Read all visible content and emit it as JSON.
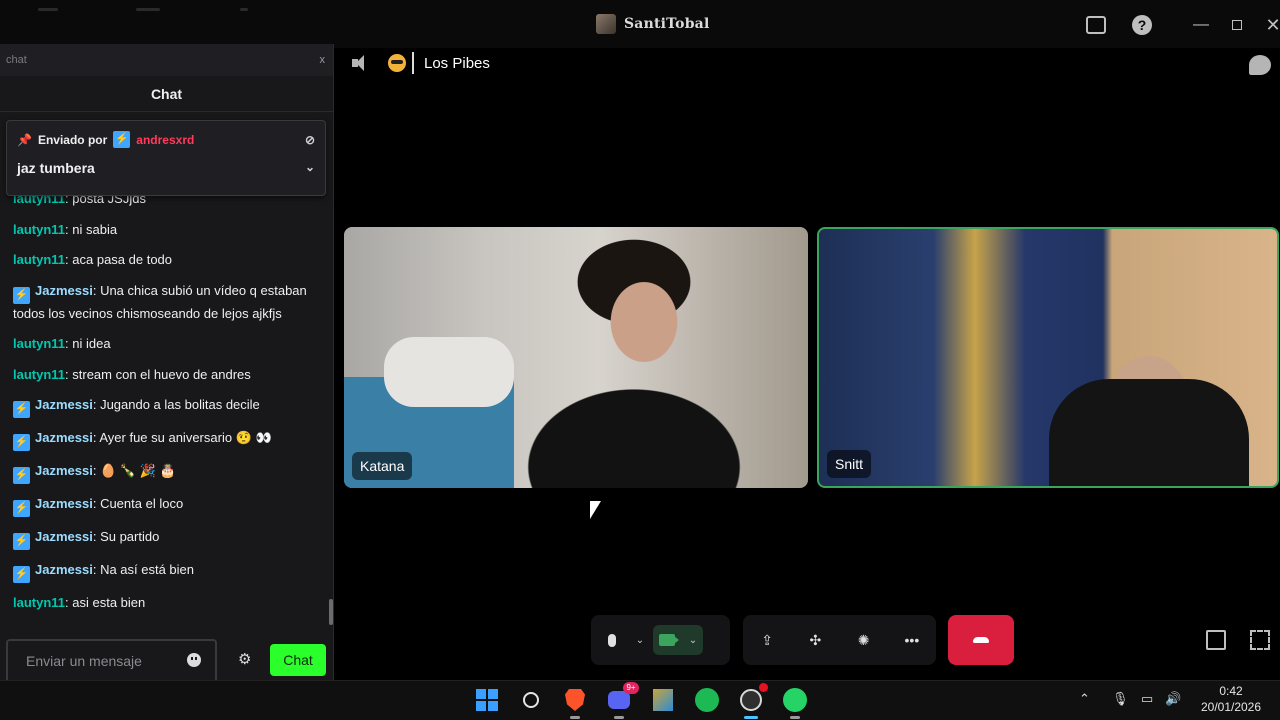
{
  "window": {
    "title": "SantiTobal"
  },
  "chat": {
    "panel_label": "chat",
    "close_label": "x",
    "heading": "Chat",
    "pinned": {
      "prefix": "Enviado por",
      "user": "andresxrd",
      "message": "jaz tumbera"
    },
    "messages": [
      {
        "user": "lautyn11",
        "text": "posta JSJjds",
        "badge": false
      },
      {
        "user": "lautyn11",
        "text": "ni sabia",
        "badge": false
      },
      {
        "user": "lautyn11",
        "text": "aca pasa de todo",
        "badge": false
      },
      {
        "user": "Jazmessi",
        "text": "Una chica subió un vídeo q estaban todos los vecinos chismoseando de lejos ajkfjs",
        "badge": true
      },
      {
        "user": "lautyn11",
        "text": "ni idea",
        "badge": false
      },
      {
        "user": "lautyn11",
        "text": "stream con el huevo de andres",
        "badge": false
      },
      {
        "user": "Jazmessi",
        "text": "Jugando a las bolitas decile",
        "badge": true
      },
      {
        "user": "Jazmessi",
        "text": "Ayer fue su aniversario 🤨 👀",
        "badge": true
      },
      {
        "user": "Jazmessi",
        "text": "🥚 🍾 🎉 🎂",
        "badge": true
      },
      {
        "user": "Jazmessi",
        "text": "Cuenta el loco",
        "badge": true
      },
      {
        "user": "Jazmessi",
        "text": "Su partido",
        "badge": true
      },
      {
        "user": "Jazmessi",
        "text": "Na así está bien",
        "badge": true
      },
      {
        "user": "lautyn11",
        "text": "asi esta bien",
        "badge": false
      }
    ],
    "input_placeholder": "Enviar un mensaje",
    "send_label": "Chat"
  },
  "call": {
    "group_name": "Los Pibes",
    "participants": [
      {
        "name": "Katana"
      },
      {
        "name": "Snitt"
      }
    ]
  },
  "taskbar": {
    "discord_badge": "9+",
    "time": "0:42",
    "date": "20/01/2026"
  },
  "colors": {
    "accent_green": "#3ba55d",
    "end_call_red": "#da1e3d",
    "chat_send_green": "#2bff2b",
    "user_laut": "#00c8af",
    "user_jaz": "#9adcff",
    "pinned_user": "#ff3b5c"
  }
}
